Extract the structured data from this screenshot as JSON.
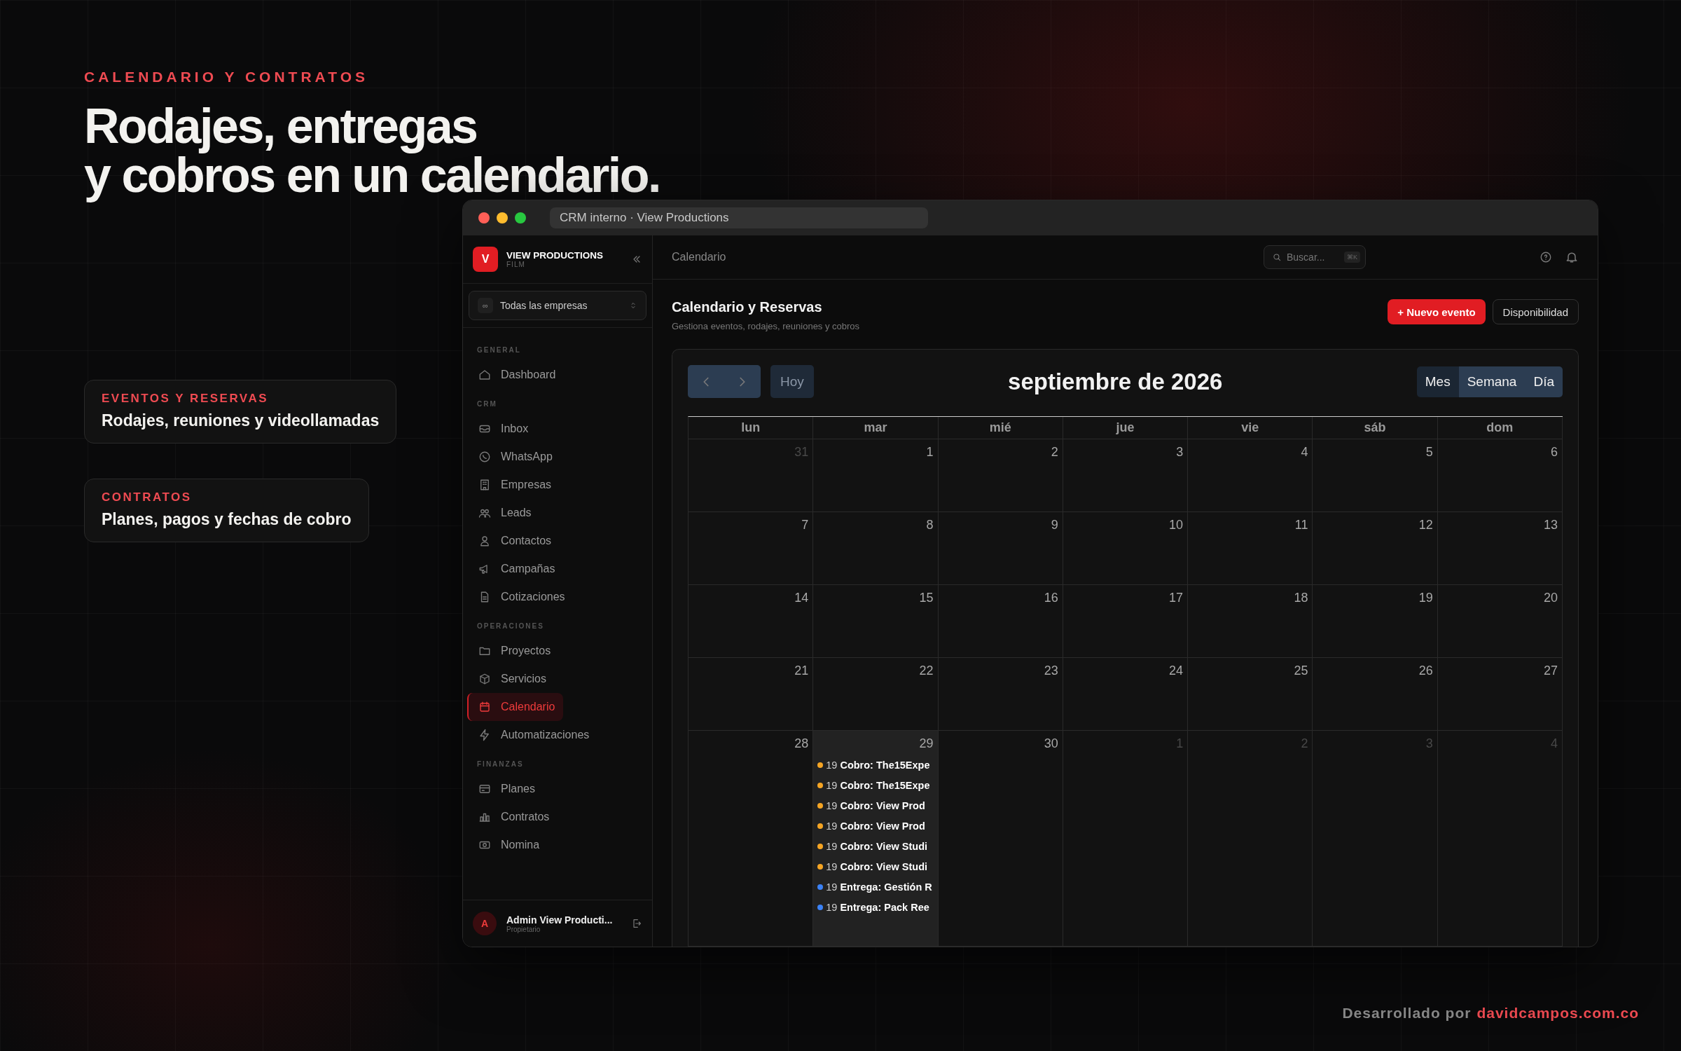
{
  "eyebrow": "CALENDARIO Y CONTRATOS",
  "headline": [
    "Rodajes, entregas",
    "y cobros en un calendario."
  ],
  "feature_cards": [
    {
      "label": "EVENTOS Y RESERVAS",
      "text": "Rodajes, reuniones y videollamadas"
    },
    {
      "label": "CONTRATOS",
      "text": "Planes, pagos y fechas de cobro"
    }
  ],
  "window": {
    "title": "CRM interno · View Productions"
  },
  "sidebar": {
    "brand": {
      "logo": "V",
      "name": "VIEW PRODUCTIONS",
      "subtitle": "FILM"
    },
    "company_picker": {
      "icon": "∞",
      "value": "Todas las empresas"
    },
    "sections": [
      {
        "heading": "GENERAL",
        "items": [
          {
            "label": "Dashboard",
            "selected": false
          }
        ]
      },
      {
        "heading": "CRM",
        "items": [
          {
            "label": "Inbox",
            "selected": false
          },
          {
            "label": "WhatsApp",
            "selected": false
          },
          {
            "label": "Empresas",
            "selected": false
          },
          {
            "label": "Leads",
            "selected": false
          },
          {
            "label": "Contactos",
            "selected": false
          },
          {
            "label": "Campañas",
            "selected": false
          },
          {
            "label": "Cotizaciones",
            "selected": false
          }
        ]
      },
      {
        "heading": "OPERACIONES",
        "items": [
          {
            "label": "Proyectos",
            "selected": false
          },
          {
            "label": "Servicios",
            "selected": false
          },
          {
            "label": "Calendario",
            "selected": true
          },
          {
            "label": "Automatizaciones",
            "selected": false
          }
        ]
      },
      {
        "heading": "FINANZAS",
        "items": [
          {
            "label": "Planes",
            "selected": false
          },
          {
            "label": "Contratos",
            "selected": false
          },
          {
            "label": "Nomina",
            "selected": false
          }
        ]
      }
    ],
    "user": {
      "avatar": "A",
      "name": "Admin View Producti...",
      "role": "Propietario"
    }
  },
  "topbar": {
    "breadcrumb": "Calendario",
    "search": {
      "placeholder": "Buscar...",
      "shortcut": "⌘K"
    }
  },
  "page_header": {
    "title": "Calendario y Reservas",
    "subtitle": "Gestiona eventos, rodajes, reuniones y cobros",
    "buttons": [
      {
        "label": "+ Nuevo evento",
        "kind": "primary"
      },
      {
        "label": "Disponibilidad",
        "kind": "secondary"
      }
    ]
  },
  "calendar": {
    "title": "septiembre de 2026",
    "today_button": "Hoy",
    "views": [
      {
        "label": "Mes",
        "selected": true
      },
      {
        "label": "Semana",
        "selected": false
      },
      {
        "label": "Día",
        "selected": false
      }
    ],
    "weekdays": [
      "lun",
      "mar",
      "mié",
      "jue",
      "vie",
      "sáb",
      "dom"
    ],
    "weeks": [
      [
        {
          "day": "31",
          "outside": true,
          "today": false
        },
        {
          "day": "1",
          "outside": false,
          "today": false
        },
        {
          "day": "2",
          "outside": false,
          "today": false
        },
        {
          "day": "3",
          "outside": false,
          "today": false
        },
        {
          "day": "4",
          "outside": false,
          "today": false
        },
        {
          "day": "5",
          "outside": false,
          "today": false
        },
        {
          "day": "6",
          "outside": false,
          "today": false
        }
      ],
      [
        {
          "day": "7",
          "outside": false,
          "today": false
        },
        {
          "day": "8",
          "outside": false,
          "today": false
        },
        {
          "day": "9",
          "outside": false,
          "today": false
        },
        {
          "day": "10",
          "outside": false,
          "today": false
        },
        {
          "day": "11",
          "outside": false,
          "today": false
        },
        {
          "day": "12",
          "outside": false,
          "today": false
        },
        {
          "day": "13",
          "outside": false,
          "today": false
        }
      ],
      [
        {
          "day": "14",
          "outside": false,
          "today": false
        },
        {
          "day": "15",
          "outside": false,
          "today": false
        },
        {
          "day": "16",
          "outside": false,
          "today": false
        },
        {
          "day": "17",
          "outside": false,
          "today": false
        },
        {
          "day": "18",
          "outside": false,
          "today": false
        },
        {
          "day": "19",
          "outside": false,
          "today": false
        },
        {
          "day": "20",
          "outside": false,
          "today": false
        }
      ],
      [
        {
          "day": "21",
          "outside": false,
          "today": false
        },
        {
          "day": "22",
          "outside": false,
          "today": false
        },
        {
          "day": "23",
          "outside": false,
          "today": false
        },
        {
          "day": "24",
          "outside": false,
          "today": false
        },
        {
          "day": "25",
          "outside": false,
          "today": false
        },
        {
          "day": "26",
          "outside": false,
          "today": false
        },
        {
          "day": "27",
          "outside": false,
          "today": false
        }
      ],
      [
        {
          "day": "28",
          "outside": false,
          "today": false
        },
        {
          "day": "29",
          "outside": false,
          "today": true,
          "events": [
            {
              "time": "19",
              "title": "Cobro: The15Expe",
              "color": "#f5a524"
            },
            {
              "time": "19",
              "title": "Cobro: The15Expe",
              "color": "#f5a524"
            },
            {
              "time": "19",
              "title": "Cobro: View Prod",
              "color": "#f5a524"
            },
            {
              "time": "19",
              "title": "Cobro: View Prod",
              "color": "#f5a524"
            },
            {
              "time": "19",
              "title": "Cobro: View Studi",
              "color": "#f5a524"
            },
            {
              "time": "19",
              "title": "Cobro: View Studi",
              "color": "#f5a524"
            },
            {
              "time": "19",
              "title": "Entrega: Gestión R",
              "color": "#3b82f6"
            },
            {
              "time": "19",
              "title": "Entrega: Pack Ree",
              "color": "#3b82f6"
            }
          ]
        },
        {
          "day": "30",
          "outside": false,
          "today": false
        },
        {
          "day": "1",
          "outside": true,
          "today": false
        },
        {
          "day": "2",
          "outside": true,
          "today": false
        },
        {
          "day": "3",
          "outside": true,
          "today": false
        },
        {
          "day": "4",
          "outside": true,
          "today": false
        }
      ]
    ]
  },
  "credit": {
    "text": "Desarrollado por",
    "link": "davidcampos.com.co"
  }
}
